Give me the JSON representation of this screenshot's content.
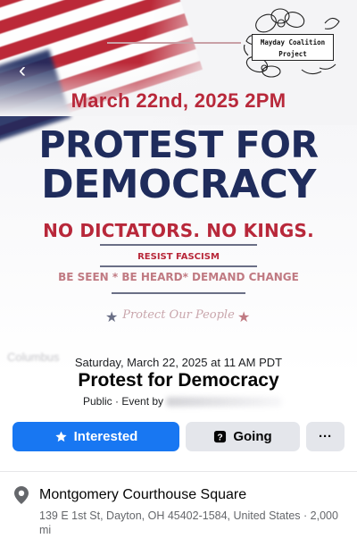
{
  "banner": {
    "logo_line1": "Mayday Coalition",
    "logo_line2": "Project",
    "date_line": "March 22nd, 2025 2PM",
    "headline_line1": "PROTEST FOR",
    "headline_line2": "DEMOCRACY",
    "kings_line": "NO DICTATORS. NO KINGS.",
    "resist_line": "RESIST FASCISM",
    "seen_line": "BE SEEN * BE HEARD* DEMAND CHANGE",
    "script_line": "Protect Our People",
    "ghost_text": "Columbus",
    "colors": {
      "red": "#b8283a",
      "navy": "#1f2c5c"
    }
  },
  "nav": {
    "back_icon": "chevron-left-icon",
    "back_glyph": "‹"
  },
  "event": {
    "datetime": "Saturday, March 22, 2025 at 11 AM PDT",
    "title": "Protest for Democracy",
    "meta_prefix": "Public · Event by"
  },
  "actions": {
    "interested_label": "Interested",
    "going_label": "Going",
    "more_label": "···",
    "accent": "#1877f2"
  },
  "location": {
    "icon": "map-pin-icon",
    "name": "Montgomery Courthouse Square",
    "address": "139 E 1st St, Dayton, OH 45402-1584, United States · 2,000 mi"
  }
}
